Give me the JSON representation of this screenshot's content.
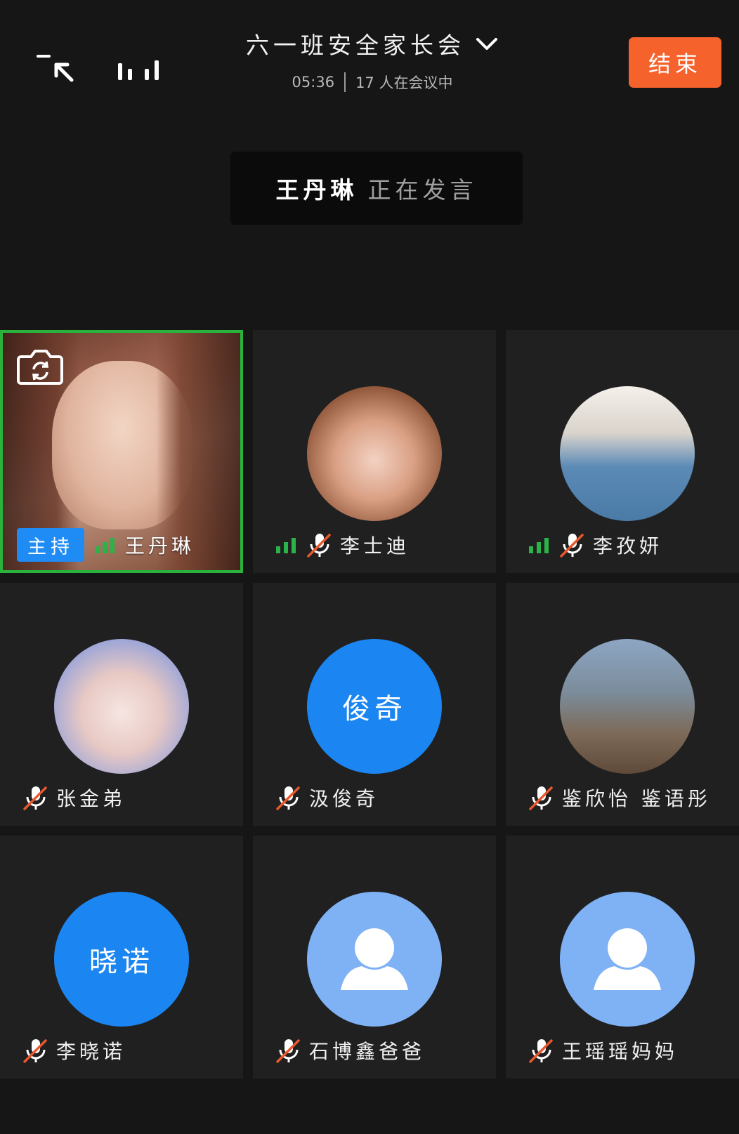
{
  "header": {
    "title": "六一班安全家长会",
    "timer": "05:36",
    "participants": "17 人在会议中",
    "end_label": "结束"
  },
  "speaking": {
    "name": "王丹琳",
    "status": "正在发言"
  },
  "self_tile": {
    "host_label": "主持",
    "name": "王丹琳"
  },
  "participants": [
    {
      "name": "李士迪",
      "avatar": "photo",
      "muted": true,
      "signal": true
    },
    {
      "name": "李孜妍",
      "avatar": "photo",
      "muted": true,
      "signal": true
    },
    {
      "name": "张金弟",
      "avatar": "photo",
      "muted": true,
      "signal": false
    },
    {
      "name": "汲俊奇",
      "avatar": "text",
      "avatar_text": "俊奇",
      "muted": true,
      "signal": false
    },
    {
      "name": "鉴欣怡 鉴语彤",
      "avatar": "photo",
      "muted": true,
      "signal": false
    },
    {
      "name": "李晓诺",
      "avatar": "text",
      "avatar_text": "晓诺",
      "muted": true,
      "signal": false
    },
    {
      "name": "石博鑫爸爸",
      "avatar": "default",
      "muted": true,
      "signal": false
    },
    {
      "name": "王瑶瑶妈妈",
      "avatar": "default",
      "muted": true,
      "signal": false
    }
  ],
  "icons": [
    "shrink-window-icon",
    "signal-icon",
    "chevron-down-icon",
    "camera-switch-icon",
    "signal-bars-icon",
    "mic-muted-icon",
    "default-user-icon"
  ],
  "colors": {
    "accent": "#f5622b",
    "host_badge": "#1f8cf5",
    "active_border": "#29b33d",
    "signal": "#2bb34a",
    "muted_slash": "#e8582c",
    "text_avatar": "#1b86f2",
    "default_avatar": "#7fb1f5",
    "background": "#161616",
    "tile": "#202020"
  }
}
